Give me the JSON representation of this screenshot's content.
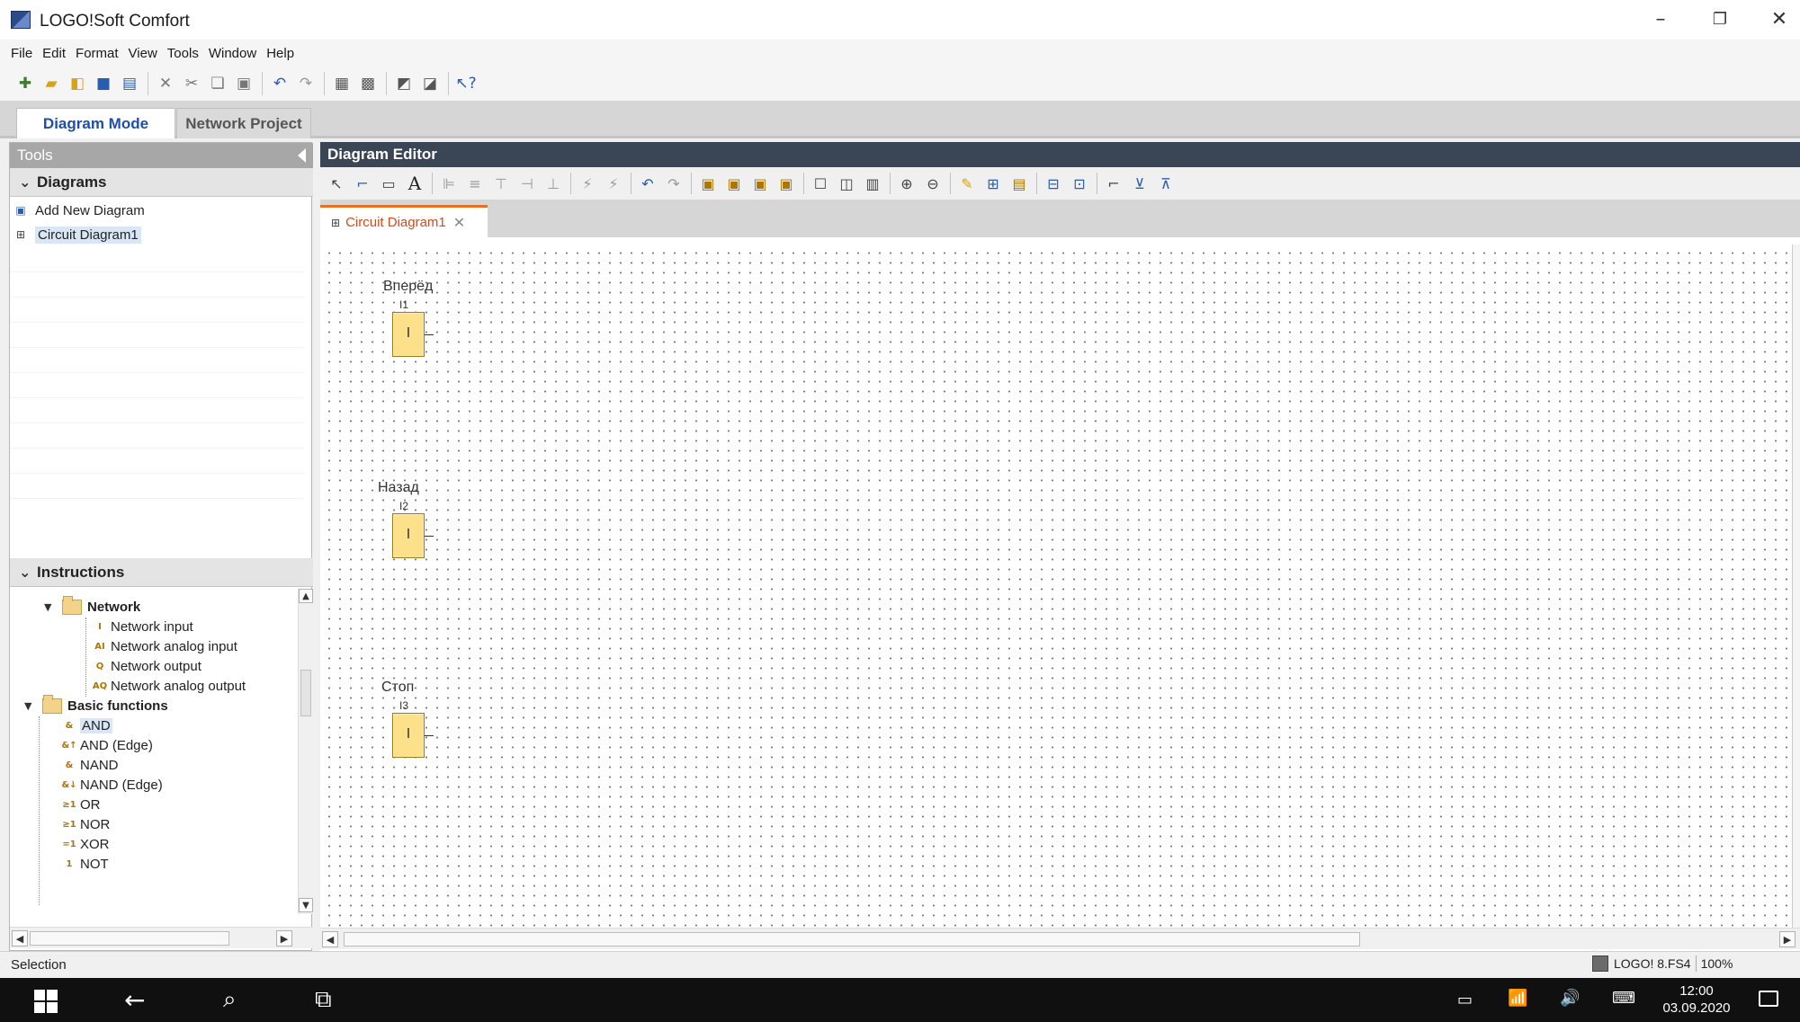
{
  "window": {
    "title": "LOGO!Soft Comfort",
    "controls": [
      "–",
      "❐",
      "✕"
    ]
  },
  "menu": [
    "File",
    "Edit",
    "Format",
    "View",
    "Tools",
    "Window",
    "Help"
  ],
  "toolbar_icons": [
    "new-icon",
    "open-icon",
    "save-icon",
    "print-icon",
    "cut-icon",
    "copy-icon",
    "paste-icon",
    "undo-icon",
    "redo-icon",
    "help-icon"
  ],
  "modes": {
    "active": "Diagram Mode",
    "inactive": "Network Project"
  },
  "tools_panel": {
    "title": "Tools",
    "diagrams_section": "Diagrams",
    "diagram_items": [
      {
        "label": "Add New Diagram",
        "icon": "add-diagram-icon"
      },
      {
        "label": "Circuit Diagram1",
        "icon": "diagram-icon",
        "selected": true
      }
    ],
    "instructions_section": "Instructions",
    "tree": {
      "network": "Network",
      "network_children": [
        "Network input",
        "Network analog input",
        "Network output",
        "Network analog output"
      ],
      "basic_functions": "Basic functions",
      "basic_children": [
        "AND",
        "AND (Edge)",
        "NAND",
        "NAND (Edge)",
        "OR",
        "NOR",
        "XOR",
        "NOT"
      ],
      "selected": "AND"
    }
  },
  "editor": {
    "title": "Diagram Editor",
    "tab_label": "Circuit Diagram1",
    "blocks": [
      {
        "name": "Вперёд",
        "id": "I1",
        "mark": "I"
      },
      {
        "name": "Назад",
        "id": "I2",
        "mark": "I"
      },
      {
        "name": "Стоп",
        "id": "I3",
        "mark": "I"
      }
    ]
  },
  "status": {
    "left": "Selection",
    "device": "LOGO! 8.FS4",
    "zoom": "100%"
  },
  "taskbar": {
    "time": "12:00",
    "date": "03.09.2020"
  },
  "colors": {
    "accent": "#1f4ea6",
    "editor_header": "#3a4556",
    "tab_accent": "#e37322",
    "block_fill": "#fce08a"
  }
}
